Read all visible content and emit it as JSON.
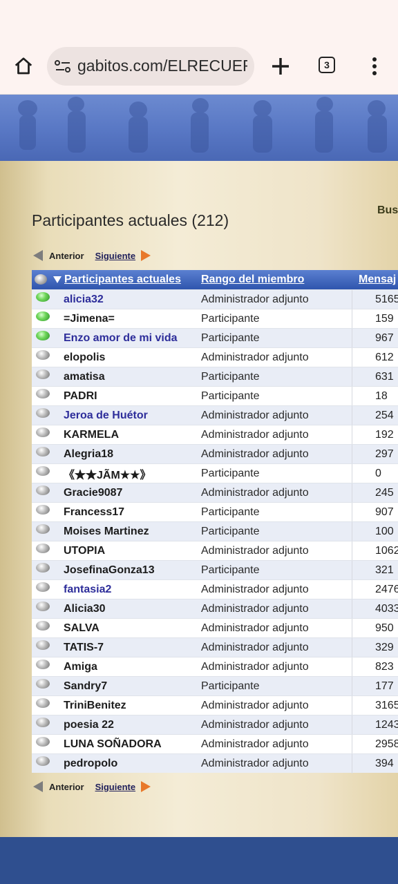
{
  "browser": {
    "url": "gabitos.com/ELRECUERI",
    "tab_count": "3"
  },
  "page": {
    "title": "Participantes actuales (212)",
    "search_label": "Bus"
  },
  "pager": {
    "prev": "Anterior",
    "next": "Siguiente"
  },
  "table": {
    "headers": {
      "name": "Participantes actuales",
      "rank": "Rango del miembro",
      "messages": "Mensaj"
    },
    "rows": [
      {
        "name": "alicia32",
        "rank": "Administrador adjunto",
        "messages": "5165",
        "online": true,
        "name_color": "blue"
      },
      {
        "name": "=Jimena=",
        "rank": "Participante",
        "messages": "159",
        "online": true,
        "name_color": "black"
      },
      {
        "name": "Enzo amor de mi vida",
        "rank": "Participante",
        "messages": "967",
        "online": true,
        "name_color": "blue"
      },
      {
        "name": "elopolis",
        "rank": "Administrador adjunto",
        "messages": "612",
        "online": false,
        "name_color": "black"
      },
      {
        "name": "amatisa",
        "rank": "Participante",
        "messages": "631",
        "online": false,
        "name_color": "black"
      },
      {
        "name": "PADRI",
        "rank": "Participante",
        "messages": "18",
        "online": false,
        "name_color": "black"
      },
      {
        "name": "Jeroa de Huétor",
        "rank": "Administrador adjunto",
        "messages": "254",
        "online": false,
        "name_color": "blue"
      },
      {
        "name": "KARMELA",
        "rank": "Administrador adjunto",
        "messages": "192",
        "online": false,
        "name_color": "black"
      },
      {
        "name": "Alegria18",
        "rank": "Administrador adjunto",
        "messages": "297",
        "online": false,
        "name_color": "black"
      },
      {
        "name": "《★★JÃM★★》",
        "rank": "Participante",
        "messages": "0",
        "online": false,
        "name_color": "black"
      },
      {
        "name": "Gracie9087",
        "rank": "Administrador adjunto",
        "messages": "245",
        "online": false,
        "name_color": "black"
      },
      {
        "name": "Francess17",
        "rank": "Participante",
        "messages": "907",
        "online": false,
        "name_color": "black"
      },
      {
        "name": "Moises Martinez",
        "rank": "Participante",
        "messages": "100",
        "online": false,
        "name_color": "black"
      },
      {
        "name": "UTOPIA",
        "rank": "Administrador adjunto",
        "messages": "1062",
        "online": false,
        "name_color": "black"
      },
      {
        "name": "JosefinaGonza13",
        "rank": "Participante",
        "messages": "321",
        "online": false,
        "name_color": "black"
      },
      {
        "name": "fantasia2",
        "rank": "Administrador adjunto",
        "messages": "2476",
        "online": false,
        "name_color": "blue"
      },
      {
        "name": "Alicia30",
        "rank": "Administrador adjunto",
        "messages": "4033",
        "online": false,
        "name_color": "black"
      },
      {
        "name": "SALVA",
        "rank": "Administrador adjunto",
        "messages": "950",
        "online": false,
        "name_color": "black"
      },
      {
        "name": "TATIS-7",
        "rank": "Administrador adjunto",
        "messages": "329",
        "online": false,
        "name_color": "black"
      },
      {
        "name": "Amiga",
        "rank": "Administrador adjunto",
        "messages": "823",
        "online": false,
        "name_color": "black"
      },
      {
        "name": "Sandry7",
        "rank": "Participante",
        "messages": "177",
        "online": false,
        "name_color": "black"
      },
      {
        "name": "TriniBenitez",
        "rank": "Administrador adjunto",
        "messages": "3165",
        "online": false,
        "name_color": "black"
      },
      {
        "name": "poesia 22",
        "rank": "Administrador adjunto",
        "messages": "1243",
        "online": false,
        "name_color": "black"
      },
      {
        "name": "LUNA SOÑADORA",
        "rank": "Administrador adjunto",
        "messages": "2958",
        "online": false,
        "name_color": "black"
      },
      {
        "name": "pedropolo",
        "rank": "Administrador adjunto",
        "messages": "394",
        "online": false,
        "name_color": "black"
      }
    ]
  },
  "icons": {
    "home": "home-icon",
    "site_info": "site-settings-icon",
    "new_tab": "plus-icon",
    "menu": "more-vert-icon",
    "status_online": "online-status-icon",
    "status_offline": "offline-status-icon"
  },
  "colors": {
    "banner": "#5877c4",
    "table_header": "#3a60b8",
    "footer": "#2f4f8f",
    "admin_name": "#2d2d9a",
    "next_arrow": "#e8782a"
  }
}
